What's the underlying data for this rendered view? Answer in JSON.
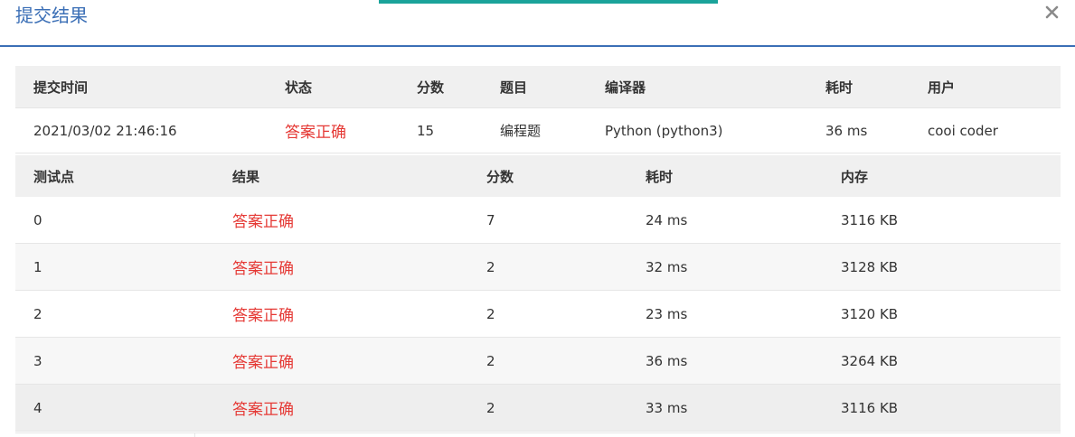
{
  "dialog": {
    "title": "提交结果",
    "close_icon": "close-icon",
    "accent_color": "#1aa39a",
    "title_color": "#3b6fb6",
    "correct_color": "#e53935"
  },
  "summary": {
    "headers": [
      "提交时间",
      "状态",
      "分数",
      "题目",
      "编译器",
      "耗时",
      "用户"
    ],
    "row": {
      "time": "2021/03/02 21:46:16",
      "status": "答案正确",
      "score": "15",
      "problem": "编程题",
      "compiler": "Python (python3)",
      "cost": "36 ms",
      "user": "cooi coder"
    }
  },
  "cases": {
    "headers": [
      "测试点",
      "结果",
      "分数",
      "耗时",
      "内存"
    ],
    "rows": [
      {
        "id": "0",
        "result": "答案正确",
        "score": "7",
        "time": "24 ms",
        "memory": "3116 KB"
      },
      {
        "id": "1",
        "result": "答案正确",
        "score": "2",
        "time": "32 ms",
        "memory": "3128 KB"
      },
      {
        "id": "2",
        "result": "答案正确",
        "score": "2",
        "time": "23 ms",
        "memory": "3120 KB"
      },
      {
        "id": "3",
        "result": "答案正确",
        "score": "2",
        "time": "36 ms",
        "memory": "3264 KB"
      },
      {
        "id": "4",
        "result": "答案正确",
        "score": "2",
        "time": "33 ms",
        "memory": "3116 KB"
      }
    ]
  }
}
